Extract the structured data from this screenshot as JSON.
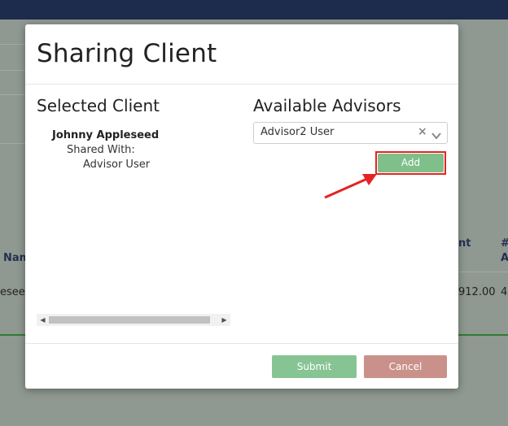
{
  "background": {
    "header_col_name": "Nam",
    "header_col_amount": "nt",
    "header_col_extra_1": "#",
    "header_col_extra_2": "A",
    "row_name": "eseed",
    "row_amount": "912.00",
    "row_extra": "4"
  },
  "modal": {
    "title": "Sharing Client",
    "selected_client": {
      "heading": "Selected Client",
      "client_name": "Johnny Appleseed",
      "shared_with_label": "Shared With:",
      "shared_users": [
        "Advisor User"
      ]
    },
    "available_advisors": {
      "heading": "Available Advisors",
      "selected_value": "Advisor2 User",
      "clear_icon": "×",
      "add_label": "Add"
    },
    "footer": {
      "submit_label": "Submit",
      "cancel_label": "Cancel"
    }
  },
  "colors": {
    "topbar": "#1d2b4d",
    "add_button": "#7fbf8a",
    "submit_button": "#86c493",
    "cancel_button": "#c9918a",
    "highlight": "#e52323"
  }
}
